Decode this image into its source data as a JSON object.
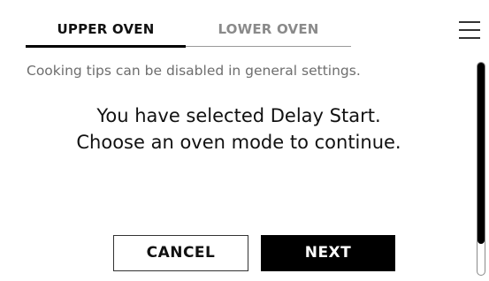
{
  "tabs": [
    {
      "label": "UPPER OVEN",
      "active": true
    },
    {
      "label": "LOWER OVEN",
      "active": false
    }
  ],
  "menu": {
    "icon": "hamburger-menu-icon"
  },
  "tip": "Cooking tips can be disabled in general settings.",
  "message": {
    "line1": "You have selected Delay Start.",
    "line2": "Choose an oven mode to continue."
  },
  "buttons": {
    "cancel": "CANCEL",
    "next": "NEXT"
  },
  "colors": {
    "text": "#111111",
    "inactive_tab": "#8a8a8a",
    "tip_text": "#6e6e6e",
    "primary_button_bg": "#000000",
    "primary_button_text": "#ffffff"
  }
}
